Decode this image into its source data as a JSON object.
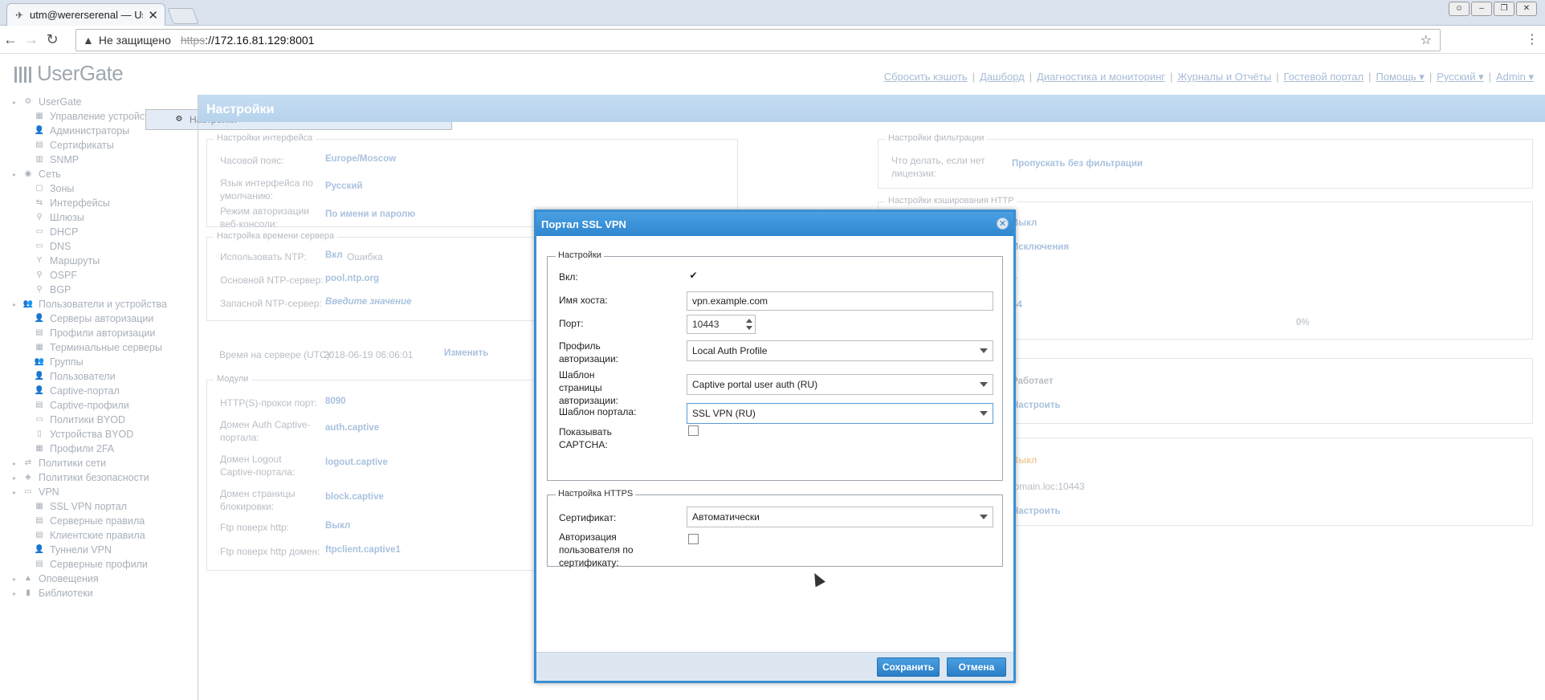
{
  "browser": {
    "tab_title": "utm@wererserenal — Us",
    "insecure_label": "Не защищено",
    "url_scheme": "https",
    "url_rest": "://172.16.81.129:8001"
  },
  "app": {
    "logo": "UserGate",
    "topnav": [
      "Сбросить кэшоть",
      "Дашборд",
      "Диагностика и мониторинг",
      "Журналы и Отчёты",
      "Гостевой портал",
      "Помощь ▾",
      "Русский ▾",
      "Admin ▾"
    ]
  },
  "sidebar": {
    "items": [
      {
        "label": "UserGate",
        "level": 0,
        "icon": "⚙"
      },
      {
        "label": "Настройки",
        "level": 1,
        "icon": "⚙",
        "selected": true
      },
      {
        "label": "Управление устройством",
        "level": 1,
        "icon": "▦"
      },
      {
        "label": "Администраторы",
        "level": 1,
        "icon": "👤"
      },
      {
        "label": "Сертификаты",
        "level": 1,
        "icon": "▤"
      },
      {
        "label": "SNMP",
        "level": 1,
        "icon": "▥"
      },
      {
        "label": "Сеть",
        "level": 0,
        "icon": "◉"
      },
      {
        "label": "Зоны",
        "level": 1,
        "icon": "▢"
      },
      {
        "label": "Интерфейсы",
        "level": 1,
        "icon": "⇆"
      },
      {
        "label": "Шлюзы",
        "level": 1,
        "icon": "⚲"
      },
      {
        "label": "DHCP",
        "level": 1,
        "icon": "▭"
      },
      {
        "label": "DNS",
        "level": 1,
        "icon": "▭"
      },
      {
        "label": "Маршруты",
        "level": 1,
        "icon": "Y"
      },
      {
        "label": "OSPF",
        "level": 1,
        "icon": "⚲"
      },
      {
        "label": "BGP",
        "level": 1,
        "icon": "⚲"
      },
      {
        "label": "Пользователи и устройства",
        "level": 0,
        "icon": "👥"
      },
      {
        "label": "Серверы авторизации",
        "level": 1,
        "icon": "👤"
      },
      {
        "label": "Профили авторизации",
        "level": 1,
        "icon": "▤"
      },
      {
        "label": "Терминальные серверы",
        "level": 1,
        "icon": "▦"
      },
      {
        "label": "Группы",
        "level": 1,
        "icon": "👥"
      },
      {
        "label": "Пользователи",
        "level": 1,
        "icon": "👤"
      },
      {
        "label": "Captive-портал",
        "level": 1,
        "icon": "👤"
      },
      {
        "label": "Captive-профили",
        "level": 1,
        "icon": "▤"
      },
      {
        "label": "Политики BYOD",
        "level": 1,
        "icon": "▭"
      },
      {
        "label": "Устройства BYOD",
        "level": 1,
        "icon": "▯"
      },
      {
        "label": "Профили 2FA",
        "level": 1,
        "icon": "▦"
      },
      {
        "label": "Политики сети",
        "level": 0,
        "icon": "⇄"
      },
      {
        "label": "Политики безопасности",
        "level": 0,
        "icon": "◈"
      },
      {
        "label": "VPN",
        "level": 0,
        "icon": "▭"
      },
      {
        "label": "SSL VPN портал",
        "level": 1,
        "icon": "▦"
      },
      {
        "label": "Серверные правила",
        "level": 1,
        "icon": "▤"
      },
      {
        "label": "Клиентские правила",
        "level": 1,
        "icon": "▤"
      },
      {
        "label": "Туннели VPN",
        "level": 1,
        "icon": "👤"
      },
      {
        "label": "Серверные профили",
        "level": 1,
        "icon": "▤"
      },
      {
        "label": "Оповещения",
        "level": 0,
        "icon": "▲"
      },
      {
        "label": "Библиотеки",
        "level": 0,
        "icon": "▮"
      }
    ]
  },
  "main": {
    "title": "Настройки",
    "interface": {
      "legend": "Настройки интерфейса",
      "tz_label": "Часовой пояс:",
      "tz_value": "Europe/Moscow",
      "lang_label": "Язык интерфейса по умолчанию:",
      "lang_value": "Русский",
      "auth_label": "Режим авторизации веб-консоли:",
      "auth_value": "По имени и паролю"
    },
    "time": {
      "legend": "Настройка времени сервера",
      "ntp_label": "Использовать NTP:",
      "ntp_value": "Вкл",
      "ntp_error": "Ошибка",
      "main_label": "Основной NTP-сервер:",
      "main_value": "pool.ntp.org",
      "backup_label": "Запасной NTP-сервер:",
      "backup_value": "Введите значение",
      "server_label": "Время на сервере (UTC):",
      "server_value": "2018-06-19 06:06:01",
      "change": "Изменить"
    },
    "modules": {
      "legend": "Модули",
      "proxy_label": "HTTP(S)-прокси порт:",
      "proxy_value": "8090",
      "auth_label": "Домен Auth Captive-портала:",
      "auth_value": "auth.captive",
      "logout_label": "Домен Logout Captive-портала:",
      "logout_value": "logout.captive",
      "block_label": "Домен страницы блокировки:",
      "block_value": "block.captive",
      "ftp_label": "Ftp поверх http:",
      "ftp_value": "Выкл",
      "ftpd_label": "Ftp поверх http домен:",
      "ftpd_value": "ftpclient.captive1"
    },
    "filter": {
      "legend": "Настройки фильтрации",
      "label": "Что делать, если нет лицензии:",
      "value": "Пропускать без фильтрации"
    },
    "cache": {
      "legend": "Настройки кэширования HTTP",
      "v1": "Выкл",
      "v2": "Исключения",
      "v3": "1",
      "v4": "64",
      "progress": "0%"
    },
    "right3": {
      "v1": "Работает",
      "v2": "Настроить"
    },
    "right4": {
      "v1": "Выкл",
      "v2": "domain.loc:10443",
      "v3": "Настроить"
    }
  },
  "modal": {
    "title": "Портал SSL VPN",
    "settings_legend": "Настройки",
    "enabled_label": "Вкл:",
    "host_label": "Имя хоста:",
    "host_value": "vpn.example.com",
    "port_label": "Порт:",
    "port_value": "10443",
    "auth_profile_label": "Профиль авторизации:",
    "auth_profile_value": "Local Auth Profile",
    "auth_tpl_label": "Шаблон страницы авторизации:",
    "auth_tpl_value": "Captive portal user auth (RU)",
    "portal_tpl_label": "Шаблон портала:",
    "portal_tpl_value": "SSL VPN (RU)",
    "captcha_label": "Показывать CAPTCHA:",
    "https_legend": "Настройка HTTPS",
    "cert_label": "Сертификат:",
    "cert_value": "Автоматически",
    "cert_auth_label": "Авторизация пользователя по сертификату:",
    "save": "Сохранить",
    "cancel": "Отмена"
  }
}
